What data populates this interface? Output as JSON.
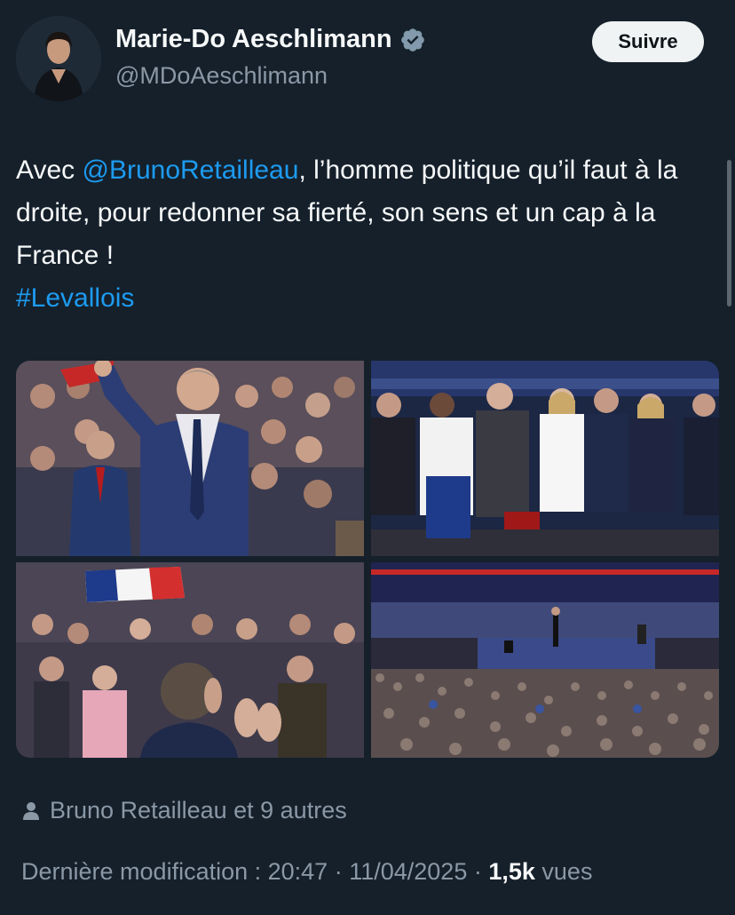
{
  "author": {
    "name": "Marie-Do Aeschlimann",
    "handle": "@MDoAeschlimann",
    "avatar_icon": "profile-photo",
    "verified_icon": "verified-badge-icon"
  },
  "follow_button": {
    "label": "Suivre"
  },
  "tweet": {
    "prefix": "Avec ",
    "mention": "@BrunoRetailleau",
    "text": ", l’homme politique qu’il faut à la droite, pour redonner sa fierté, son sens et un cap à la France !",
    "hashtag": "#Levallois"
  },
  "media": [
    {
      "icon": "photo-retailleau-waving"
    },
    {
      "icon": "photo-front-row-applause"
    },
    {
      "icon": "photo-crowd-flag"
    },
    {
      "icon": "photo-arena-meeting"
    }
  ],
  "tagged": {
    "icon": "person-icon",
    "text": "Bruno Retailleau et 9 autres"
  },
  "meta": {
    "edited_label": "Dernière modification : ",
    "time": "20:47",
    "separator": " · ",
    "date": "11/04/2025",
    "separator2": " · ",
    "views_count": "1,5k",
    "views_label": " vues"
  },
  "colors": {
    "background": "#15202b",
    "link": "#1d9bf0",
    "secondary_text": "#8b98a5",
    "verified": "#829aab"
  }
}
